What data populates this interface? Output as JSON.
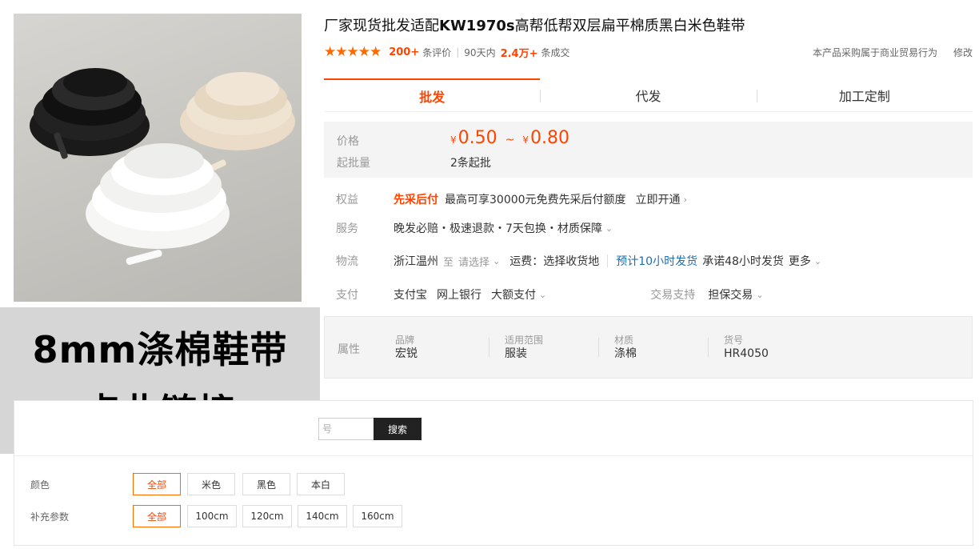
{
  "product": {
    "title_part1": "厂家现货批发适配",
    "title_model": "KW1970s",
    "title_part2": "高帮低帮双层扁平棉质黑白米色鞋带",
    "stars": "★★★★★",
    "review_count": "200+",
    "review_label": "条评价",
    "period": "90天内",
    "sold_count": "2.4万+",
    "sold_label": "条成交",
    "trade_note": "本产品采购属于商业贸易行为",
    "trade_note_more": "修改"
  },
  "overlay": {
    "line1": "8mm涤棉鞋带",
    "line2": "点此链接"
  },
  "tabs": [
    {
      "label": "批发",
      "active": true
    },
    {
      "label": "代发",
      "active": false
    },
    {
      "label": "加工定制",
      "active": false
    }
  ],
  "pricing": {
    "price_label": "价格",
    "currency": "¥",
    "price_min": "0.50",
    "price_tilde": "~",
    "price_max": "0.80",
    "moq_label": "起批量",
    "moq": "2条起批"
  },
  "benefits": {
    "label": "权益",
    "tag": "先采后付",
    "text": "最高可享30000元免费先采后付额度",
    "action": "立即开通",
    "action_chevron": "›"
  },
  "service": {
    "label": "服务",
    "text": "晚发必赔・极速退款・7天包换・材质保障",
    "chevron": "⌄"
  },
  "logistics": {
    "label": "物流",
    "origin": "浙江温州",
    "to": "至",
    "select": "请选择",
    "chevron": "⌄",
    "freight": "运费：选择收货地",
    "ship_estimate": "预计10小时发货",
    "promise": "承诺48小时发货",
    "more": "更多",
    "more_chevron": "⌄"
  },
  "payment": {
    "label": "支付",
    "methods": [
      "支付宝",
      "网上银行",
      "大额支付"
    ],
    "chevron": "⌄",
    "trade_support_label": "交易支持",
    "trade_support": "担保交易",
    "trade_chevron": "⌄"
  },
  "attributes": {
    "label": "属性",
    "items": [
      {
        "key": "品牌",
        "value": "宏锐"
      },
      {
        "key": "适用范围",
        "value": "服装"
      },
      {
        "key": "材质",
        "value": "涤棉"
      },
      {
        "key": "货号",
        "value": "HR4050"
      }
    ]
  },
  "filters": {
    "search_placeholder_tail": "号",
    "search_button": "搜索",
    "color_label": "颜色",
    "colors": [
      "全部",
      "米色",
      "黑色",
      "本白"
    ],
    "param_label": "补充参数",
    "params": [
      "全部",
      "100cm",
      "120cm",
      "140cm",
      "160cm"
    ]
  },
  "colors": {
    "accent": "#ff4400",
    "star": "#ff6a00",
    "link_blue": "#1a6eb3"
  }
}
